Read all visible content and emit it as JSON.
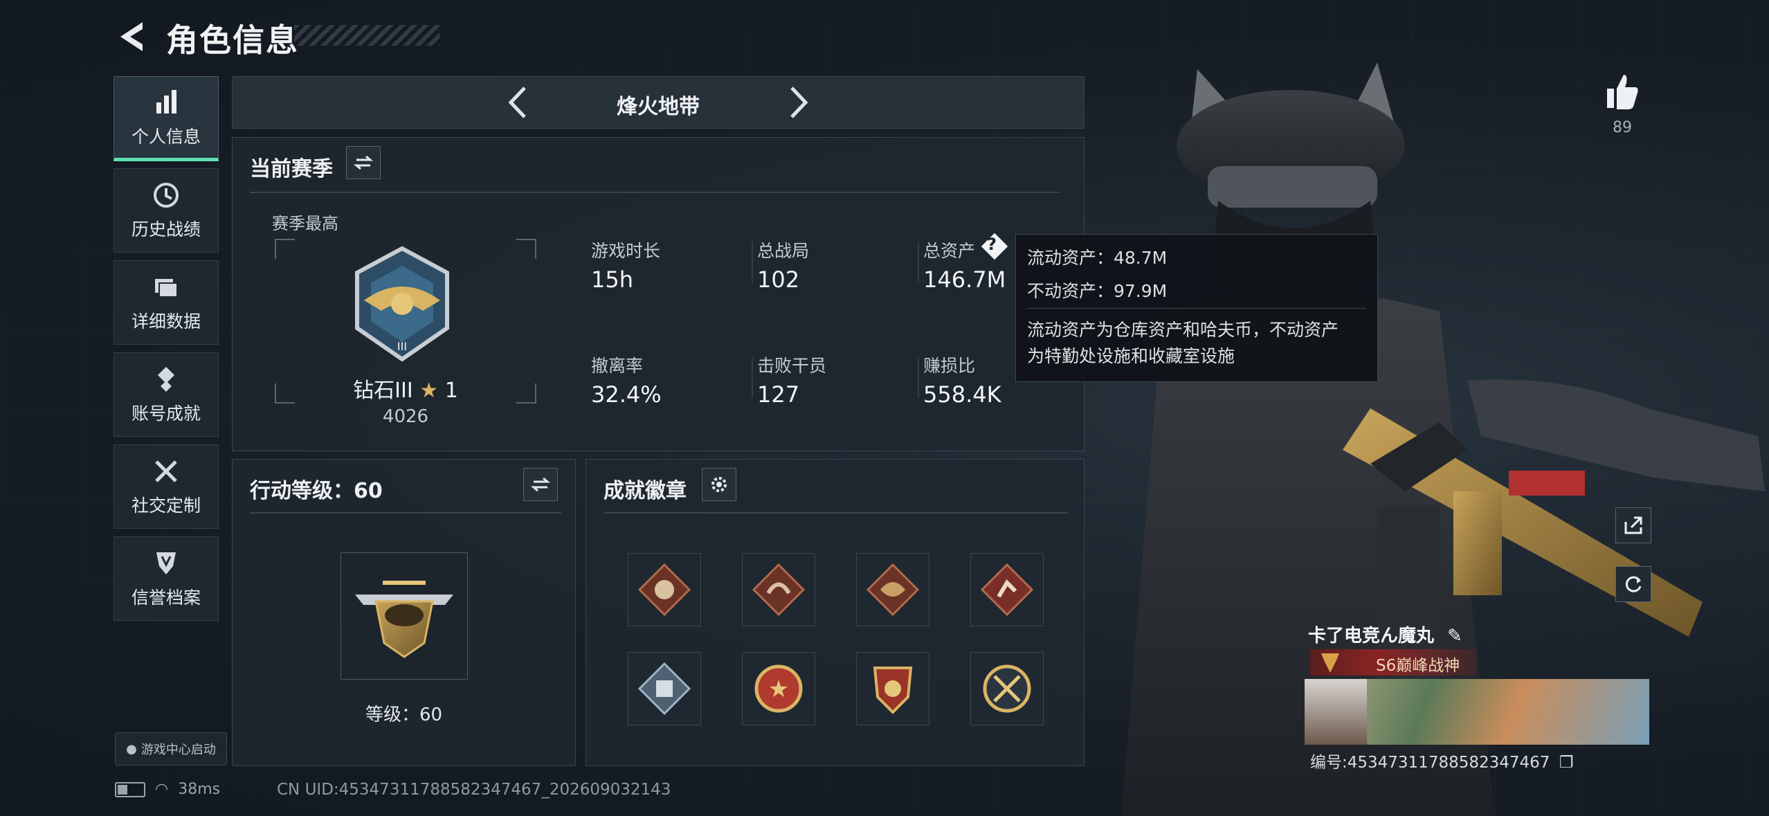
{
  "header": {
    "title": "角色信息"
  },
  "nav": {
    "items": [
      {
        "label": "个人信息",
        "icon": "bar-chart-icon",
        "active": true
      },
      {
        "label": "历史战绩",
        "icon": "clock-icon",
        "active": false
      },
      {
        "label": "详细数据",
        "icon": "folder-icon",
        "active": false
      },
      {
        "label": "账号成就",
        "icon": "achievement-icon",
        "active": false
      },
      {
        "label": "社交定制",
        "icon": "tools-icon",
        "active": false
      },
      {
        "label": "信誉档案",
        "icon": "shield-icon",
        "active": false
      }
    ],
    "launch_label": "游戏中心启动"
  },
  "mode": {
    "name": "烽火地带"
  },
  "season": {
    "title": "当前赛季",
    "highest_label": "赛季最高",
    "rank_name": "钻石III",
    "rank_stars": "1",
    "rank_score": "4026",
    "stats": [
      {
        "label": "游戏时长",
        "value": "15h"
      },
      {
        "label": "总战局",
        "value": "102"
      },
      {
        "label": "总资产",
        "value": "146.7M"
      },
      {
        "label": "撤离率",
        "value": "32.4%"
      },
      {
        "label": "击败干员",
        "value": "127"
      },
      {
        "label": "赚损比",
        "value": "558.4K"
      }
    ]
  },
  "tooltip": {
    "liquid": "流动资产：48.7M",
    "fixed": "不动资产：97.9M",
    "desc_line1": "流动资产为仓库资产和哈夫币，不动资产",
    "desc_line2": "为特勤处设施和收藏室设施"
  },
  "action_level": {
    "title": "行动等级：60",
    "level_label": "等级：60"
  },
  "achievements": {
    "title": "成就徽章",
    "badges": [
      "wolf-badge-icon",
      "dragon-badge-icon",
      "dragon-gold-badge-icon",
      "runner-badge-icon",
      "box-badge-icon",
      "star-emblem-badge-icon",
      "shield-emblem-badge-icon",
      "skull-emblem-badge-icon"
    ]
  },
  "player": {
    "likes": "89",
    "name": "卡了电竞ん魔丸",
    "title": "S6巅峰战神",
    "id_text": "编号:4534731178858234746​7"
  },
  "status": {
    "ping": "38ms",
    "uid": "CN UID:4534731178858234746​7_202609032143"
  },
  "colors": {
    "accent": "#5fe0b0",
    "title_red": "#8a2424"
  }
}
